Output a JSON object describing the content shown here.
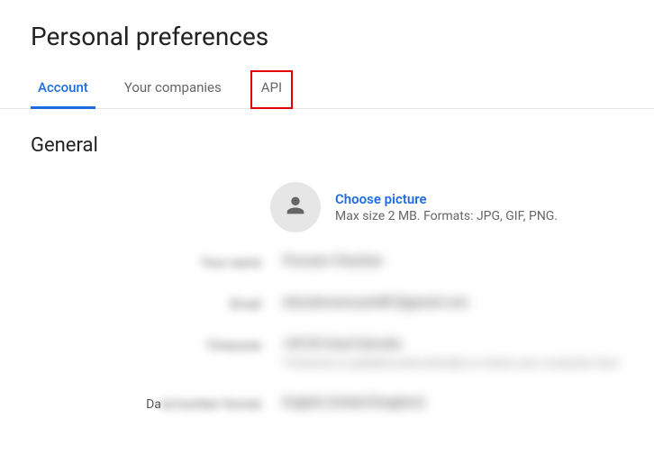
{
  "page": {
    "title": "Personal preferences"
  },
  "tabs": {
    "account": "Account",
    "companies": "Your companies",
    "api": "API"
  },
  "section": {
    "general": "General"
  },
  "avatar": {
    "choose": "Choose picture",
    "hint": "Max size 2 MB. Formats: JPG, GIF, PNG."
  },
  "fields": {
    "name_label": "Your name",
    "name_value": "Poonam Chauhan",
    "email_label": "Email",
    "email_value": "dotunknownuser887@gmail.com",
    "tz_label": "Timezone",
    "tz_value": "+05:30 Asia/Calcutta",
    "tz_sub": "Timezone is updated automatically to match your computer time",
    "date_label_prefix": "Da",
    "date_label_blur": "te/number format",
    "date_value": "English (United Kingdom)"
  }
}
